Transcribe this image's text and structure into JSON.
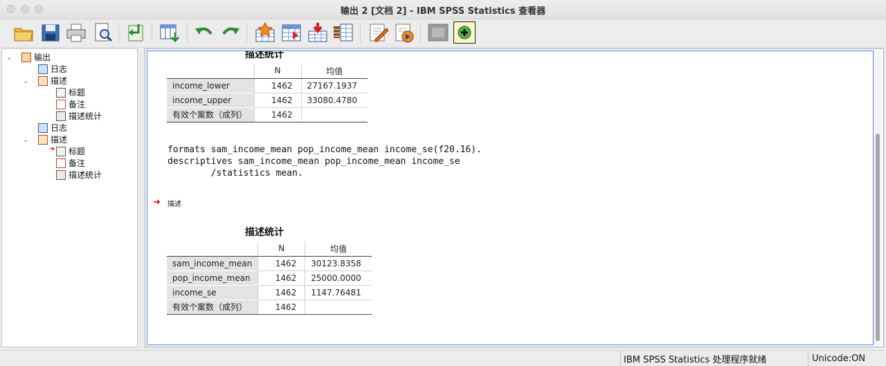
{
  "window": {
    "title": "输出 2 [文档 2] - IBM SPSS Statistics 查看器"
  },
  "toolbar": {
    "icons": [
      "open-folder-icon",
      "save-icon",
      "print-icon",
      "print-preview-icon",
      "export-icon",
      "goto-data-icon",
      "undo-icon",
      "redo-icon",
      "goto-case-icon",
      "goto-variable-icon",
      "insert-cases-icon",
      "variables-icon",
      "edit-icon",
      "designate-window-icon",
      "inactive-icon",
      "add-icon"
    ]
  },
  "tree": {
    "items": [
      {
        "label": "输出",
        "icon": "output-icon"
      },
      {
        "label": "日志",
        "icon": "log-icon"
      },
      {
        "label": "描述",
        "icon": "descriptives-icon"
      },
      {
        "label": "标题",
        "icon": "title-icon"
      },
      {
        "label": "备注",
        "icon": "notes-icon"
      },
      {
        "label": "描述统计",
        "icon": "statistics-table-icon"
      },
      {
        "label": "日志",
        "icon": "log-icon"
      },
      {
        "label": "描述",
        "icon": "descriptives-icon"
      },
      {
        "label": "标题",
        "icon": "title-icon"
      },
      {
        "label": "备注",
        "icon": "notes-icon"
      },
      {
        "label": "描述统计",
        "icon": "statistics-table-icon"
      }
    ]
  },
  "output": {
    "table1": {
      "title": "描述统计",
      "col_n": "N",
      "col_mean": "均值",
      "rows": [
        {
          "label": "income_lower",
          "n": "1462",
          "mean": "27167.1937"
        },
        {
          "label": "income_upper",
          "n": "1462",
          "mean": "33080.4780"
        },
        {
          "label": "有效个案数（成列）",
          "n": "1462",
          "mean": ""
        }
      ]
    },
    "syntax": "formats sam_income_mean pop_income_mean income_se(f20.16).\ndescriptives sam_income_mean pop_income_mean income_se\n        /statistics mean.",
    "section_label": "描述",
    "table2": {
      "title": "描述统计",
      "col_n": "N",
      "col_mean": "均值",
      "rows": [
        {
          "label": "sam_income_mean",
          "n": "1462",
          "mean": "30123.8358"
        },
        {
          "label": "pop_income_mean",
          "n": "1462",
          "mean": "25000.0000"
        },
        {
          "label": "income_se",
          "n": "1462",
          "mean": "1147.76481"
        },
        {
          "label": "有效个案数（成列）",
          "n": "1462",
          "mean": ""
        }
      ]
    }
  },
  "status": {
    "processor": "IBM SPSS Statistics 处理程序就绪",
    "unicode": "Unicode:ON"
  }
}
